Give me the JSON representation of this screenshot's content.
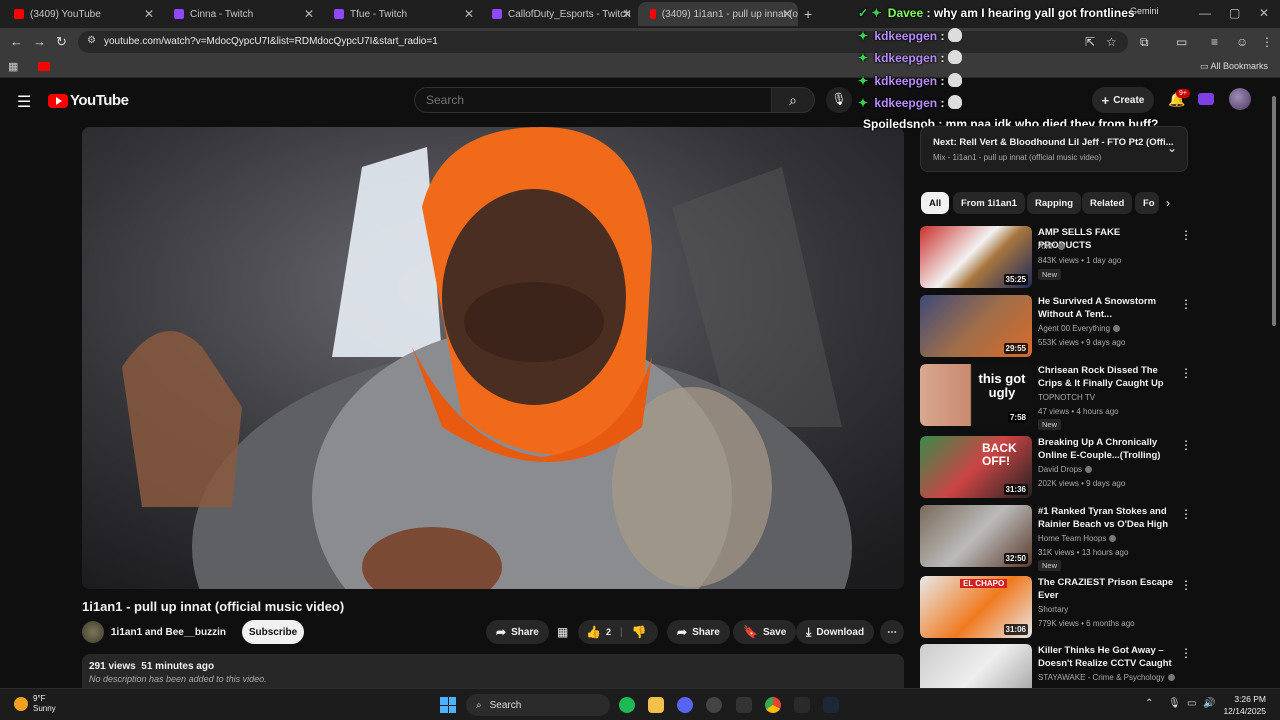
{
  "browser": {
    "tabs": [
      {
        "label": "(3409) YouTube",
        "color": "#ff0000"
      },
      {
        "label": "Cinna - Twitch",
        "color": "#9146ff"
      },
      {
        "label": "Tfue - Twitch",
        "color": "#9146ff"
      },
      {
        "label": "CallofDuty_Esports - Twitch",
        "color": "#9146ff"
      },
      {
        "label": "(3409) 1i1an1 - pull up innat (o",
        "color": "#ff0000"
      }
    ],
    "gemini_label": "Gemini",
    "url": "youtube.com/watch?v=MdocQypcU7I&list=RDMdocQypcU7I&start_radio=1",
    "all_bookmarks": "All Bookmarks"
  },
  "youtube": {
    "logo_text": "YouTube",
    "search_placeholder": "Search",
    "create_label": "Create",
    "notif_count": "9+"
  },
  "chat": [
    {
      "user": "Davee",
      "msg": "why am I hearing yall got frontlines",
      "color": "u-green",
      "badge": "✓ ✦"
    },
    {
      "user": "kdkeepgen",
      "msg": ":",
      "color": "u-purple",
      "badge": "✦"
    },
    {
      "user": "kdkeepgen",
      "msg": ":",
      "color": "u-purple",
      "badge": "✦"
    },
    {
      "user": "kdkeepgen",
      "msg": ":",
      "color": "u-purple",
      "badge": "✦"
    },
    {
      "user": "kdkeepgen",
      "msg": ":",
      "color": "u-purple",
      "badge": "✦"
    },
    {
      "user": "Spoiledsnob",
      "msg": ": mm naa idk who died they from buff?",
      "color": "u-white",
      "badge": ""
    }
  ],
  "video": {
    "title": "1i1an1 - pull up innat (official music video)",
    "channel": "1i1an1 and Bee__buzzin",
    "subscribe": "Subscribe",
    "share1": "Share",
    "likes": "2",
    "share2": "Share",
    "save": "Save",
    "download": "Download",
    "views": "291 views",
    "age": "51 minutes ago",
    "description": "No description has been added to this video."
  },
  "next": {
    "title": "Next: Rell Vert & Bloodhound Lil Jeff - FTO Pt2 (Offi...",
    "sub": "Mix - 1i1an1 - pull up innat (official music video)"
  },
  "chips": [
    "All",
    "From 1i1an1",
    "Rapping",
    "Related",
    "Fo"
  ],
  "recs": [
    {
      "title": "AMP SELLS FAKE PRODUCTS",
      "channel": "AMP",
      "views": "843K views • 1 day ago",
      "dur": "35:25",
      "new": "New",
      "verified": true,
      "thumb": "linear-gradient(135deg,#c9302c,#f2f2f2 45%,#a8763e 60%,#1d2a5c)"
    },
    {
      "title": "He Survived A Snowstorm Without A Tent...",
      "channel": "Agent 00 Everything",
      "views": "553K views • 9 days ago",
      "dur": "29:55",
      "new": "",
      "verified": true,
      "thumb": "linear-gradient(135deg,#3d4a7a,#9e6e4a 50%,#d96a2a)"
    },
    {
      "title": "Chrisean Rock Dissed The Crips & It Finally Caught Up",
      "channel": "TOPNOTCH TV",
      "views": "47 views • 4 hours ago",
      "dur": "7:58",
      "new": "New",
      "verified": false,
      "thumb": "linear-gradient(90deg,#d8a890,#c98a70 45%,#111 46%,#111)",
      "thumb_text": "this got ugly"
    },
    {
      "title": "Breaking Up A Chronically Online E-Couple...(Trolling)",
      "channel": "David Drops",
      "views": "202K views • 9 days ago",
      "dur": "31:36",
      "new": "",
      "verified": true,
      "thumb": "linear-gradient(135deg,#3a8a4a,#c44 50%,#222)",
      "thumb_text": "BACK OFF!"
    },
    {
      "title": "#1 Ranked Tyran Stokes and Rainier Beach vs O'Dea High ...",
      "channel": "Home Team Hoops",
      "views": "31K views • 13 hours ago",
      "dur": "32:50",
      "new": "New",
      "verified": true,
      "thumb": "linear-gradient(135deg,#7a6a5a,#bbb 50%,#5a3a2a)"
    },
    {
      "title": "The CRAZIEST Prison Escape Ever",
      "channel": "Shortary",
      "views": "779K views • 6 months ago",
      "dur": "31:06",
      "new": "",
      "verified": false,
      "thumb": "linear-gradient(135deg,#e8e8e8,#f07a20 55%,#e8e8e8)",
      "thumb_text": "EL CHAPO"
    },
    {
      "title": "Killer Thinks He Got Away – Doesn't Realize CCTV Caught ...",
      "channel": "STAYAWAKE - Crime & Psychology",
      "views": "",
      "dur": "",
      "new": "",
      "verified": true,
      "thumb": "linear-gradient(135deg,#ccc,#eee 50%,#9a9a9a)"
    }
  ],
  "taskbar": {
    "temp": "9°F",
    "weather": "Sunny",
    "search": "Search",
    "time": "3:26 PM",
    "date": "12/14/2025"
  }
}
